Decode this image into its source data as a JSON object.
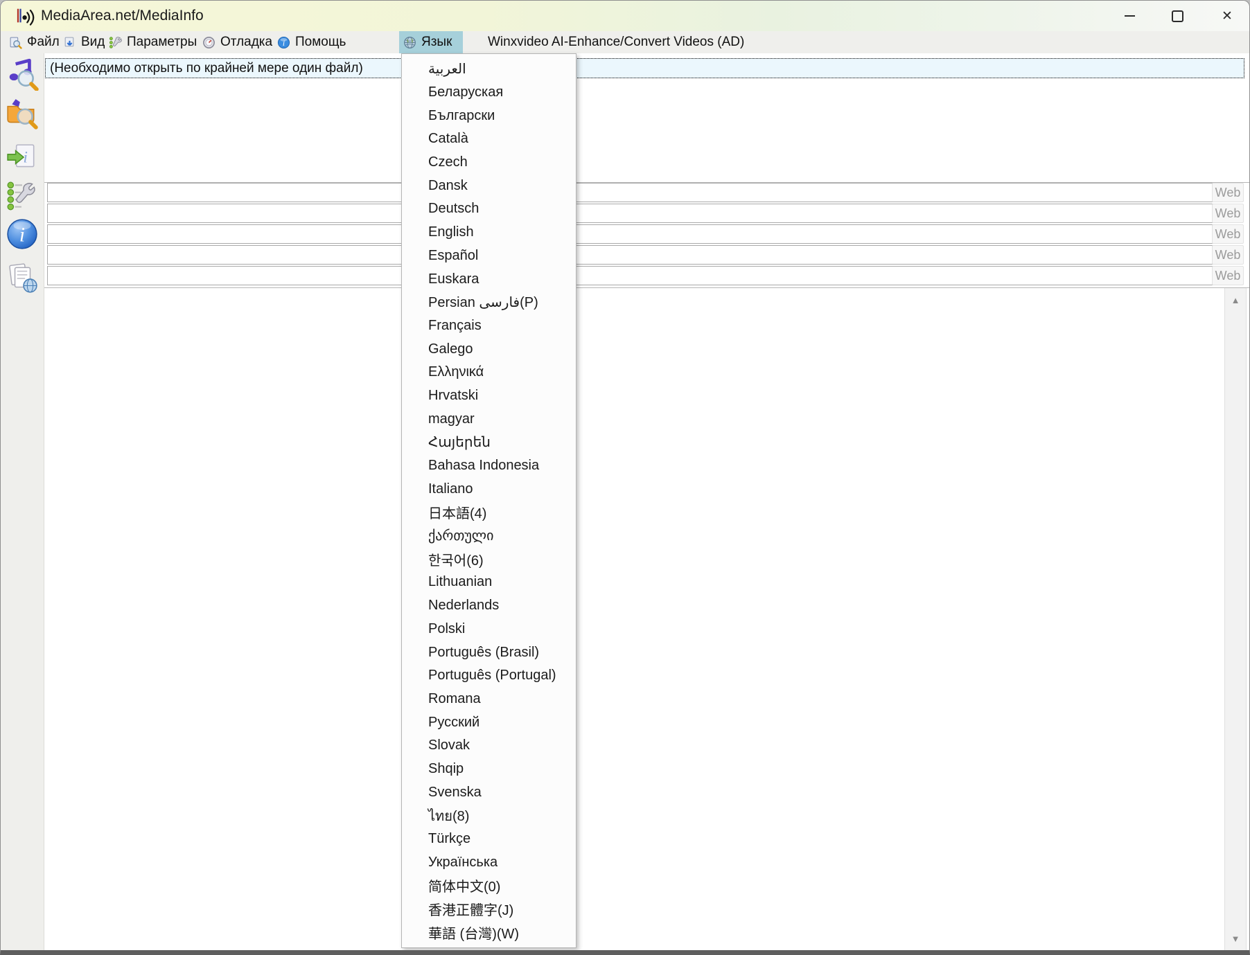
{
  "window": {
    "title": "MediaArea.net/MediaInfo",
    "controls": {
      "minimize": "minimize",
      "maximize": "maximize",
      "close": "close"
    }
  },
  "menubar": {
    "file": "Файл",
    "view": "Вид",
    "options": "Параметры",
    "debug": "Отладка",
    "help": "Помощь",
    "language": "Язык",
    "ad": "Winxvideo AI-Enhance/Convert Videos (AD)"
  },
  "toolbar": {
    "icons": [
      "open-file",
      "open-folder",
      "export-info",
      "preferences",
      "about",
      "web-report"
    ]
  },
  "main": {
    "notice": "(Необходимо открыть по крайней мере один файл)",
    "rows": [
      {
        "value": "",
        "button": "Web"
      },
      {
        "value": "",
        "button": "Web"
      },
      {
        "value": "",
        "button": "Web"
      },
      {
        "value": "",
        "button": "Web"
      },
      {
        "value": "",
        "button": "Web"
      }
    ]
  },
  "language_menu": {
    "items": [
      "العربية",
      "Беларуская",
      "Български",
      "Català",
      "Czech",
      "Dansk",
      "Deutsch",
      "English",
      "Español",
      "Euskara",
      "Persian فارسی(P)",
      "Français",
      "Galego",
      "Ελληνικά",
      "Hrvatski",
      "magyar",
      "Հայերեն",
      "Bahasa Indonesia",
      "Italiano",
      "日本語(4)",
      "ქართული",
      "한국어(6)",
      "Lithuanian",
      "Nederlands",
      "Polski",
      "Português (Brasil)",
      "Português (Portugal)",
      "Romana",
      "Русский",
      "Slovak",
      "Shqip",
      "Svenska",
      "ไทย(8)",
      "Türkçe",
      "Українська",
      "简体中文(0)",
      "香港正體字(J)",
      "華語 (台灣)(W)"
    ]
  },
  "colors": {
    "menu_highlight": "#a6d0da",
    "titlebar_left": "#f6f7d8",
    "titlebar_right": "#f7f8f6",
    "notice_background": "#ebf7fd"
  }
}
